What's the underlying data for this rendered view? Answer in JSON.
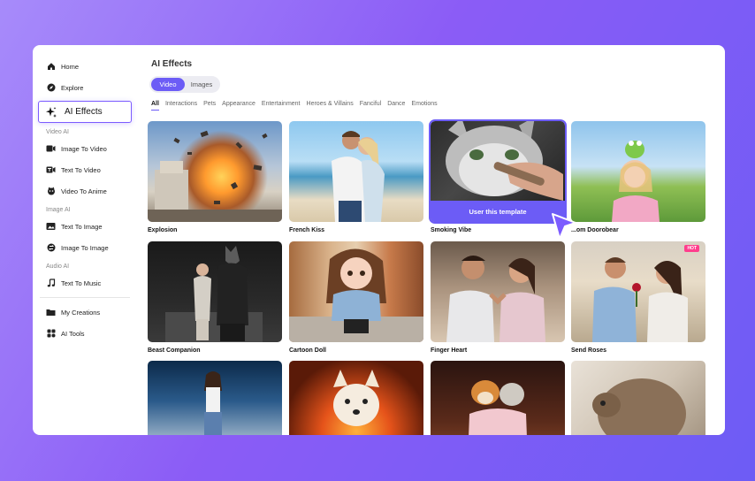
{
  "sidebar": {
    "items": [
      {
        "label": "Home",
        "icon": "home-icon"
      },
      {
        "label": "Explore",
        "icon": "compass-icon"
      },
      {
        "label": "AI Effects",
        "icon": "sparkle-icon"
      }
    ],
    "video_ai": {
      "label": "Video AI",
      "items": [
        {
          "label": "Image To Video"
        },
        {
          "label": "Text To Video"
        },
        {
          "label": "Video To Anime"
        }
      ]
    },
    "image_ai": {
      "label": "Image AI",
      "items": [
        {
          "label": "Text To Image"
        },
        {
          "label": "Image To Image"
        }
      ]
    },
    "audio_ai": {
      "label": "Audio AI",
      "items": [
        {
          "label": "Text To Music"
        }
      ]
    },
    "bottom": [
      {
        "label": "My Creations"
      },
      {
        "label": "AI Tools"
      }
    ]
  },
  "main": {
    "title": "AI Effects",
    "media_toggle": [
      "Video",
      "Images"
    ],
    "media_selected": "Video",
    "tabs": [
      "All",
      "Interactions",
      "Pets",
      "Appearance",
      "Entertainment",
      "Heroes & Villains",
      "Fanciful",
      "Dance",
      "Emotions"
    ],
    "tab_selected": "All",
    "cta": "User this template",
    "hot_badge": "HOT",
    "cards": [
      {
        "label": "Explosion"
      },
      {
        "label": "French Kiss"
      },
      {
        "label": "Smoking Vibe"
      },
      {
        "label": "...om Doorobear"
      },
      {
        "label": "Beast Companion"
      },
      {
        "label": "Cartoon Doll"
      },
      {
        "label": "Finger Heart"
      },
      {
        "label": "Send Roses"
      },
      {
        "label": ""
      },
      {
        "label": ""
      },
      {
        "label": ""
      },
      {
        "label": ""
      }
    ]
  },
  "colors": {
    "accent": "#6c5cf6",
    "hot": "#ff3e8d",
    "background_gradient_start": "#a78bfa",
    "background_gradient_end": "#6d5cf5"
  }
}
